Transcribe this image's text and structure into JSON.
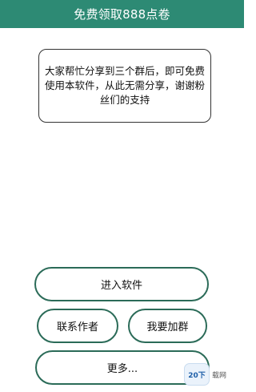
{
  "header": {
    "title": "免费领取888点卷"
  },
  "notice": {
    "text": "大家帮忙分享到三个群后，即可免费使用本软件，从此无需分享，谢谢粉丝们的支持"
  },
  "buttons": {
    "enter": "进入软件",
    "contact": "联系作者",
    "join_group": "我要加群",
    "more": "更多..."
  },
  "watermark": {
    "badge": "20下",
    "text": "载网"
  },
  "colors": {
    "header_bg": "#2d8a74",
    "button_border": "#2b6b58"
  }
}
